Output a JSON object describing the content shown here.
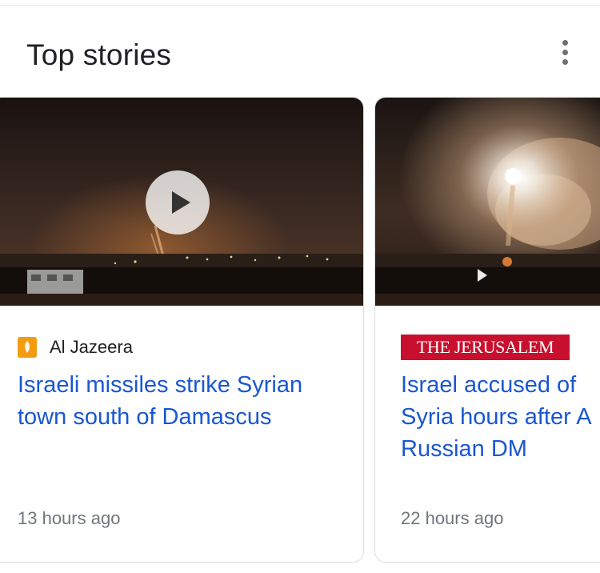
{
  "section": {
    "title": "Top stories",
    "more_icon": "more-vert-icon"
  },
  "stories": [
    {
      "source": "Al Jazeera",
      "source_icon": "al-jazeera-logo-icon",
      "headline": "Israeli missiles strike Syrian town south of Damascus",
      "time": "13 hours ago",
      "has_video": true
    },
    {
      "source": "THE JERUSALEM POST",
      "source_icon": "jerusalem-post-logo",
      "headline": "Israel accused of ... Syria hours after ... Russian DM",
      "headline_lines": [
        "Israel accused of",
        "Syria hours after A",
        "Russian DM"
      ],
      "time": "22 hours ago"
    }
  ],
  "colors": {
    "headline": "#1a57d0",
    "meta": "#70757a",
    "jpost": "#c8102e",
    "aljazeera": "#f39c12"
  }
}
